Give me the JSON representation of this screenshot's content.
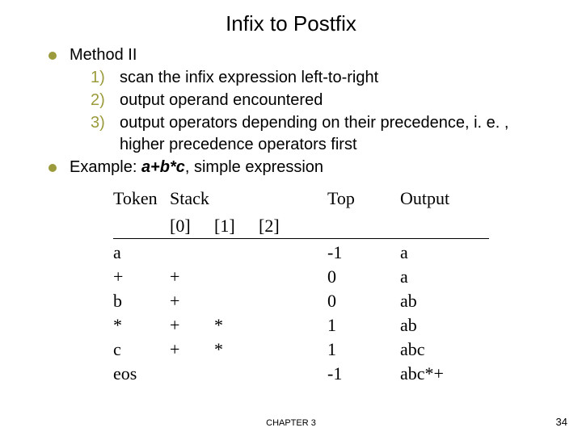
{
  "title": "Infix to Postfix",
  "bullets": {
    "b1": "Method II",
    "b2_prefix": "Example: ",
    "b2_emph": "a+b*c",
    "b2_suffix": ", simple expression"
  },
  "steps": {
    "n1": "1)",
    "t1": "scan the infix expression left-to-right",
    "n2": "2)",
    "t2": "output operand encountered",
    "n3": "3)",
    "t3": "output operators depending on their precedence, i. e. , higher precedence operators first"
  },
  "headers": {
    "token": "Token",
    "stack": "Stack",
    "s0": "[0]",
    "s1": "[1]",
    "s2": "[2]",
    "top": "Top",
    "output": "Output"
  },
  "chart_data": {
    "type": "table",
    "columns": [
      "Token",
      "Stack[0]",
      "Stack[1]",
      "Stack[2]",
      "Top",
      "Output"
    ],
    "rows": [
      {
        "token": "a",
        "s0": "",
        "s1": "",
        "s2": "",
        "top": "-1",
        "output": "a"
      },
      {
        "token": "+",
        "s0": "+",
        "s1": "",
        "s2": "",
        "top": "0",
        "output": "a"
      },
      {
        "token": "b",
        "s0": "+",
        "s1": "",
        "s2": "",
        "top": "0",
        "output": "ab"
      },
      {
        "token": "*",
        "s0": "+",
        "s1": "*",
        "s2": "",
        "top": "1",
        "output": "ab"
      },
      {
        "token": "c",
        "s0": "+",
        "s1": "*",
        "s2": "",
        "top": "1",
        "output": "abc"
      },
      {
        "token": "eos",
        "s0": "",
        "s1": "",
        "s2": "",
        "top": "-1",
        "output": "abc*+"
      }
    ]
  },
  "footer": {
    "center": "CHAPTER 3",
    "page": "34"
  }
}
